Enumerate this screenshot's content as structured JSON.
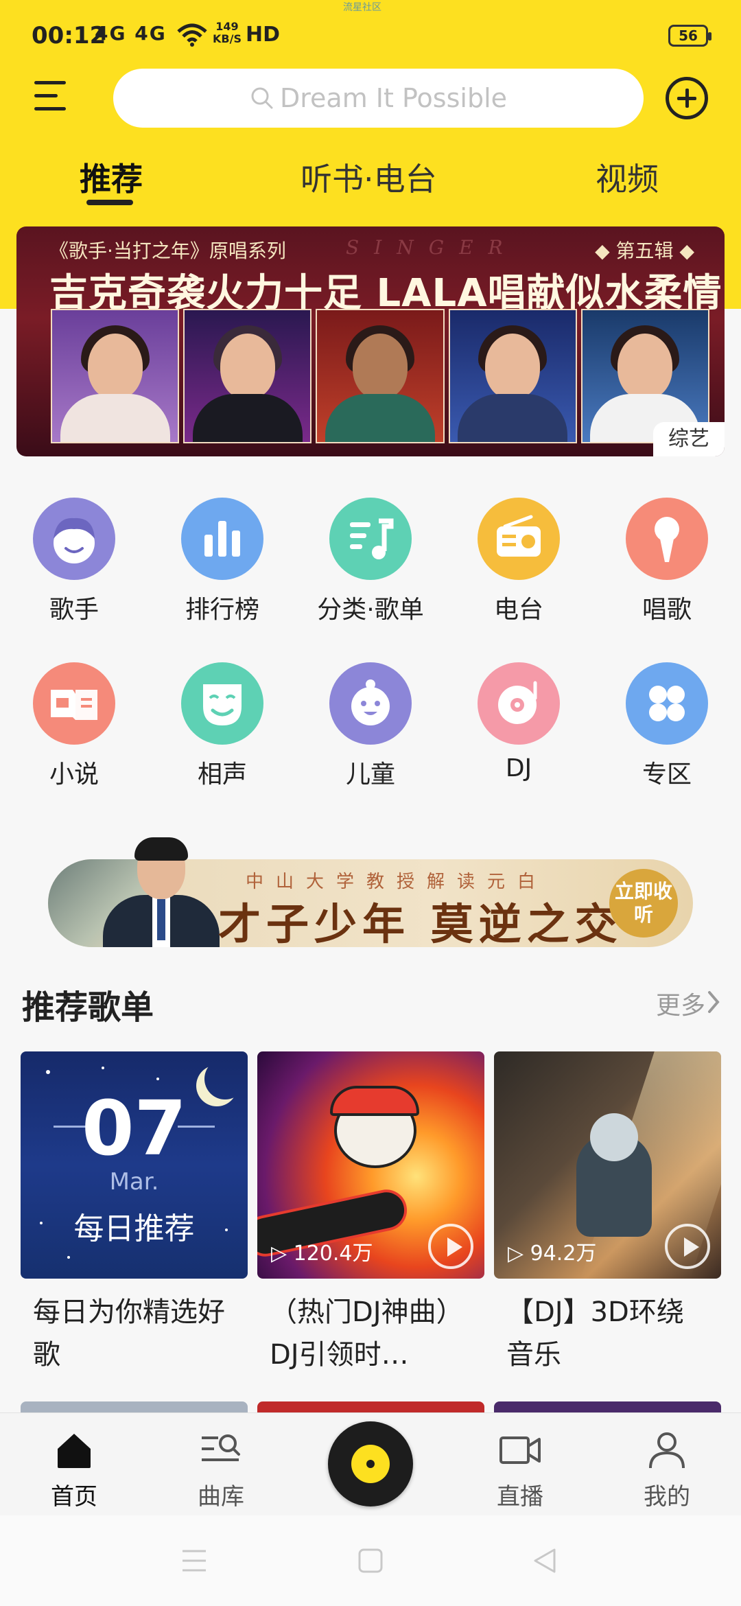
{
  "status_bar": {
    "time": "00:12",
    "network": "4G 4G",
    "speed_value": "149",
    "speed_unit": "KB/S",
    "hd": "HD",
    "center_text": "流星社区",
    "battery": "56"
  },
  "header": {
    "search_placeholder": "Dream It Possible",
    "tabs": [
      {
        "label": "推荐",
        "active": true
      },
      {
        "label": "听书·电台",
        "active": false
      },
      {
        "label": "视频",
        "active": false
      }
    ]
  },
  "banner": {
    "top_left": "《歌手·当打之年》原唱系列",
    "top_mid": "SINGER",
    "top_right": "◆ 第五辑 ◆",
    "headline": "吉克奇袭火力十足 LALA唱献似水柔情",
    "tag": "综艺"
  },
  "categories": [
    {
      "label": "歌手",
      "icon": "singer-face-icon",
      "color": "#8c86d8"
    },
    {
      "label": "排行榜",
      "icon": "bar-chart-icon",
      "color": "#6ea8ef"
    },
    {
      "label": "分类·歌单",
      "icon": "playlist-note-icon",
      "color": "#5ed1b4"
    },
    {
      "label": "电台",
      "icon": "radio-icon",
      "color": "#f6bd3c"
    },
    {
      "label": "唱歌",
      "icon": "microphone-icon",
      "color": "#f68b78"
    },
    {
      "label": "小说",
      "icon": "book-icon",
      "color": "#f58a7a"
    },
    {
      "label": "相声",
      "icon": "mask-icon",
      "color": "#5ed1b4"
    },
    {
      "label": "儿童",
      "icon": "baby-face-icon",
      "color": "#8c86d8"
    },
    {
      "label": "DJ",
      "icon": "turntable-icon",
      "color": "#f59aa8"
    },
    {
      "label": "专区",
      "icon": "grid-icon",
      "color": "#6ea8ef"
    }
  ],
  "promo": {
    "subtitle": "中山大学教授解读元白",
    "title": "才子少年 莫逆之交",
    "button": "立即收听"
  },
  "section": {
    "title": "推荐歌单",
    "more": "更多"
  },
  "playlists": [
    {
      "cover_day": "07",
      "cover_month": "Mar.",
      "cover_label": "每日推荐",
      "title": "每日为你精选好歌",
      "count": ""
    },
    {
      "title": "（热门DJ神曲）DJ引领时…",
      "count": "▷ 120.4万"
    },
    {
      "title": "【DJ】3D环绕音乐",
      "count": "▷ 94.2万"
    }
  ],
  "bottom_nav": [
    {
      "label": "首页",
      "icon": "home-icon",
      "active": true
    },
    {
      "label": "曲库",
      "icon": "library-search-icon",
      "active": false
    },
    {
      "label": "直播",
      "icon": "video-camera-icon",
      "active": false
    },
    {
      "label": "我的",
      "icon": "user-icon",
      "active": false
    }
  ],
  "colors": {
    "brand_yellow": "#fde020"
  }
}
